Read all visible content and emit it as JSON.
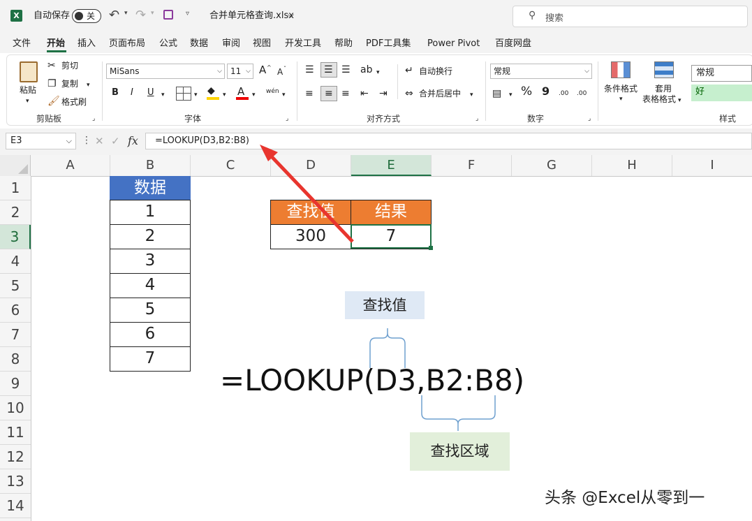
{
  "titlebar": {
    "excel_icon": "excel-logo-icon",
    "autosave_label": "自动保存",
    "autosave_state": "关",
    "filename": "合并单元格查询.xlsx",
    "filename_caret": "⌵",
    "search_placeholder": "搜索"
  },
  "tabs": [
    {
      "label": "文件"
    },
    {
      "label": "开始",
      "active": true
    },
    {
      "label": "插入"
    },
    {
      "label": "页面布局"
    },
    {
      "label": "公式"
    },
    {
      "label": "数据"
    },
    {
      "label": "审阅"
    },
    {
      "label": "视图"
    },
    {
      "label": "开发工具"
    },
    {
      "label": "帮助"
    },
    {
      "label": "PDF工具集"
    },
    {
      "label": "Power Pivot"
    },
    {
      "label": "百度网盘"
    }
  ],
  "ribbon": {
    "clipboard": {
      "paste": "粘贴",
      "cut": "剪切",
      "copy": "复制",
      "format_painter": "格式刷",
      "group": "剪贴板"
    },
    "font": {
      "name": "MiSans",
      "size": "11",
      "bold": "B",
      "italic": "I",
      "underline": "U",
      "font_color_glyph": "A",
      "phonetic_glyph": "wén",
      "grow": "A",
      "shrink": "A",
      "group": "字体"
    },
    "alignment": {
      "wrap": "自动换行",
      "merge": "合并后居中",
      "group": "对齐方式"
    },
    "number": {
      "format": "常规",
      "percent": "%",
      "comma": "9",
      "inc_dec": ".00",
      "group": "数字"
    },
    "styles": {
      "conditional": "条件格式",
      "table_format_1": "套用",
      "table_format_2": "表格格式",
      "normal": "常规",
      "good": "好",
      "group": "样式"
    },
    "accent_good": "#c6efce"
  },
  "formula_bar": {
    "name_box": "E3",
    "cancel": "✕",
    "enter": "✓",
    "fx": "fx",
    "formula": "=LOOKUP(D3,B2:B8)"
  },
  "grid": {
    "columns": [
      "A",
      "B",
      "C",
      "D",
      "E",
      "F",
      "G",
      "H",
      "I"
    ],
    "selected_column": "E",
    "rows": [
      "1",
      "2",
      "3",
      "4",
      "5",
      "6",
      "7",
      "8",
      "9",
      "10",
      "11",
      "12",
      "13",
      "14"
    ],
    "selected_row": "3",
    "data_header": "数据",
    "data_values": [
      "1",
      "2",
      "3",
      "4",
      "5",
      "6",
      "7"
    ],
    "lookup_header": "查找值",
    "result_header": "结果",
    "lookup_value": "300",
    "result_value": "7",
    "colors": {
      "blue_header": "#4472c4",
      "orange_header": "#ed7d31",
      "selection": "#1e7145"
    }
  },
  "annotations": {
    "lookup_value_note": "查找值",
    "lookup_range_note": "查找区域",
    "big_formula": "=LOOKUP(D3,B2:B8)",
    "note_blue_bg": "#dfe9f5",
    "note_green_bg": "#e2efda",
    "arrow_color": "#e8352e"
  },
  "watermark": "头条 @Excel从零到一"
}
